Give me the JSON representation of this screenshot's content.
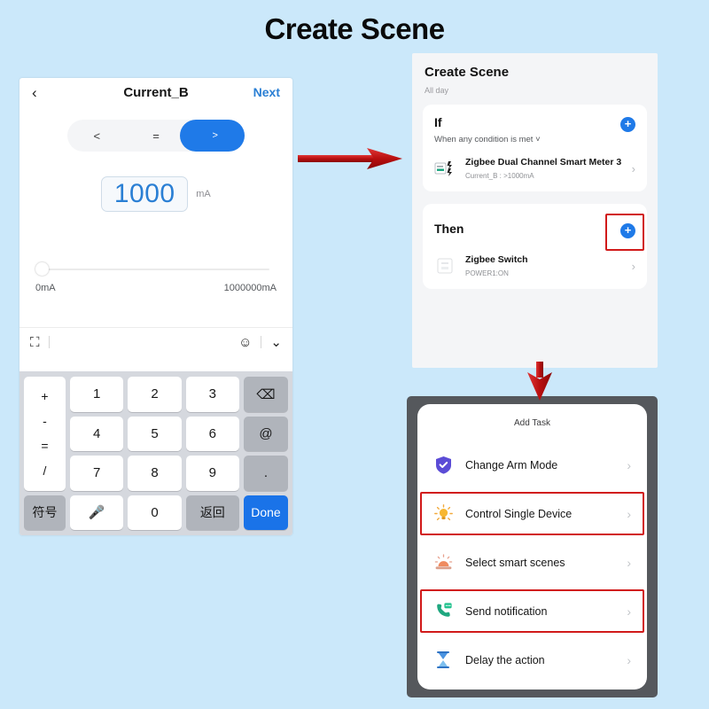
{
  "page": {
    "title": "Create Scene",
    "background_color": "#cbe8fa",
    "accent_blue": "#1f7ae8",
    "highlight_red": "#d11a1a"
  },
  "left_phone": {
    "nav": {
      "back_icon": "chevron-left-icon",
      "title": "Current_B",
      "next_label": "Next"
    },
    "comparator": {
      "options": [
        "<",
        "=",
        ">"
      ],
      "selected": ">"
    },
    "value": {
      "current": "1000",
      "unit": "mA"
    },
    "slider": {
      "min_label": "0mA",
      "max_label": "1000000mA",
      "position_percent": 0
    },
    "ime_bar": {
      "left_icon": "ime-switcher-icon",
      "emoji_icon": "emoji-icon",
      "collapse_icon": "chevron-down-icon"
    },
    "keyboard": {
      "operators": [
        "+",
        "-",
        "=",
        "/"
      ],
      "digits": [
        "1",
        "2",
        "3",
        "4",
        "5",
        "6",
        "7",
        "8",
        "9"
      ],
      "backspace_icon": "backspace-icon",
      "at_key": "@",
      "dot_key": ".",
      "symbols_key": "符号",
      "mic_icon": "microphone-icon",
      "zero_key": "0",
      "return_key": "返回",
      "done_key": "Done"
    }
  },
  "scene_panel": {
    "header_title": "Create Scene",
    "header_subtitle": "All day",
    "if_section": {
      "title": "If",
      "subtitle": "When any condition is met",
      "add_icon": "plus-circle-icon",
      "device": {
        "icon": "smart-meter-icon",
        "name": "Zigbee Dual Channel Smart Meter 3",
        "detail": "Current_B : >1000mA",
        "chevron": "chevron-right-icon"
      }
    },
    "then_section": {
      "title": "Then",
      "add_icon": "plus-circle-icon",
      "highlighted": true,
      "device": {
        "icon": "zigbee-switch-icon",
        "name": "Zigbee Switch",
        "detail": "POWER1:ON",
        "chevron": "chevron-right-icon"
      }
    }
  },
  "task_phone": {
    "title": "Add Task",
    "items": [
      {
        "label": "Change Arm Mode",
        "icon": "shield-check-icon",
        "chevron": "chevron-right-icon",
        "highlighted": false
      },
      {
        "label": "Control Single Device",
        "icon": "bulb-icon",
        "chevron": "chevron-right-icon",
        "highlighted": true
      },
      {
        "label": "Select smart scenes",
        "icon": "scene-sunrise-icon",
        "chevron": "chevron-right-icon",
        "highlighted": false
      },
      {
        "label": "Send notification",
        "icon": "phone-message-icon",
        "chevron": "chevron-right-icon",
        "highlighted": true
      },
      {
        "label": "Delay the action",
        "icon": "hourglass-icon",
        "chevron": "chevron-right-icon",
        "highlighted": false
      }
    ]
  },
  "arrows": [
    {
      "name": "arrow-to-scene-panel",
      "direction": "right",
      "color": "#cc1111"
    },
    {
      "name": "arrow-to-add-task",
      "direction": "down",
      "color": "#cc1111"
    }
  ]
}
